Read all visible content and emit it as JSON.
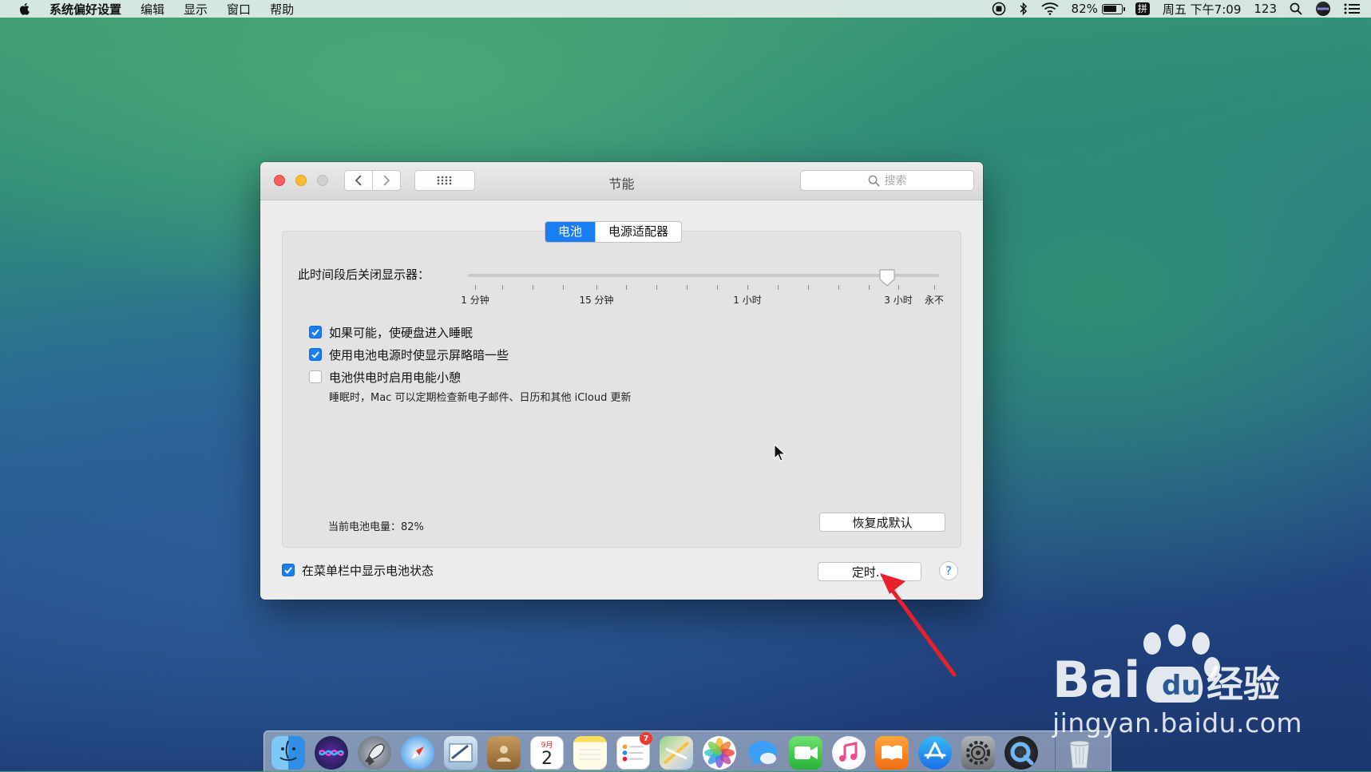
{
  "menubar": {
    "app_name": "系统偏好设置",
    "menus": [
      "编辑",
      "显示",
      "窗口",
      "帮助"
    ],
    "battery_percent": "82%",
    "battery_level": 0.82,
    "input_method": "拼",
    "clock": "周五 下午7:09",
    "user": "123",
    "icons": [
      "record-icon",
      "bluetooth-icon",
      "wifi-icon",
      "battery-icon",
      "search-icon",
      "siri-icon",
      "notification-list-icon"
    ]
  },
  "window": {
    "title": "节能",
    "search_placeholder": "搜索",
    "tabs": [
      {
        "label": "电池",
        "active": true
      },
      {
        "label": "电源适配器",
        "active": false
      }
    ],
    "slider": {
      "label": "此时间段后关闭显示器：",
      "tick_labels": [
        "1 分钟",
        "15 分钟",
        "1 小时",
        "3 小时",
        "永不"
      ],
      "value": "3 小时"
    },
    "options": [
      {
        "label": "如果可能，使硬盘进入睡眠",
        "checked": true
      },
      {
        "label": "使用电池电源时使显示屏略暗一些",
        "checked": true
      },
      {
        "label": "电池供电时启用电能小憩",
        "checked": false
      }
    ],
    "power_nap_note": "睡眠时，Mac 可以定期检查新电子邮件、日历和其他 iCloud 更新",
    "battery_status": "当前电池电量：82%",
    "restore_defaults_label": "恢复成默认",
    "show_battery_label": "在菜单栏中显示电池状态",
    "show_battery_checked": true,
    "schedule_label": "定时...",
    "help_label": "?"
  },
  "dock": {
    "items": [
      "finder",
      "siri",
      "launchpad",
      "safari",
      "mail",
      "contacts",
      "calendar",
      "notes",
      "reminders",
      "maps",
      "photos",
      "messages",
      "facetime",
      "itunes",
      "ibooks",
      "app-store",
      "system-preferences",
      "quicktime",
      "trash"
    ],
    "calendar_month": "9月",
    "calendar_day": "2",
    "reminders_badge": "7"
  },
  "watermark": {
    "brand": "Bai",
    "brand_cn": "经验",
    "url": "jingyan.baidu.com"
  },
  "colors": {
    "accent": "#1a7df2",
    "close": "#fc5f57",
    "minimize": "#fdbc2e",
    "annotation_arrow": "#e8202a"
  }
}
